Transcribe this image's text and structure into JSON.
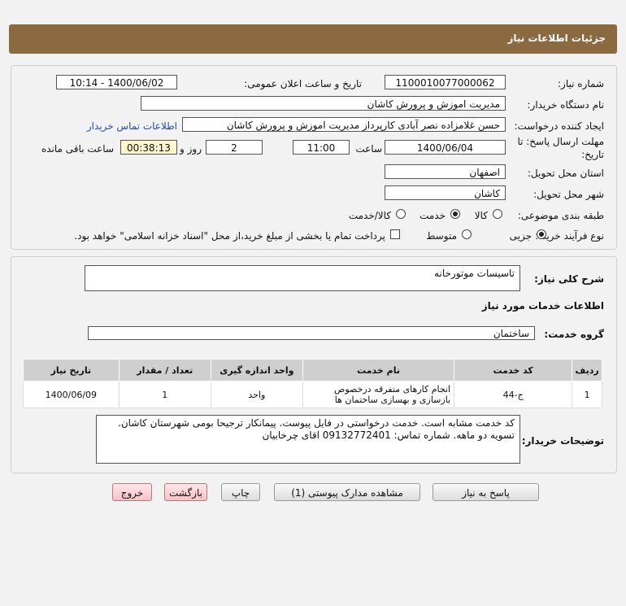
{
  "header": {
    "title": "جزئیات اطلاعات نیاز"
  },
  "fields": {
    "need_number_label": "شماره نیاز:",
    "need_number": "1100010077000062",
    "announce_label": "تاریخ و ساعت اعلان عمومی:",
    "announce_value": "1400/06/02 - 10:14",
    "buyer_org_label": "نام دستگاه خریدار:",
    "buyer_org": "مدیریت اموزش و پرورش کاشان",
    "requester_label": "ایجاد کننده درخواست:",
    "requester": "حسن غلامزاده نصر آبادی کارپرداز مدیریت اموزش و پرورش کاشان",
    "contact_link": "اطلاعات تماس خریدار",
    "deadline_label_1": "مهلت ارسال پاسخ: تا",
    "deadline_label_2": "تاریخ:",
    "deadline_date": "1400/06/04",
    "time_label": "ساعت",
    "deadline_time": "11:00",
    "days_value": "2",
    "days_label": "روز و",
    "remaining_time": "00:38:13",
    "remaining_label": "ساعت باقی مانده",
    "province_label": "استان محل تحویل:",
    "province": "اصفهان",
    "city_label": "شهر محل تحویل:",
    "city": "کاشان",
    "category_label": "طبقه بندی موضوعی:",
    "category_options": [
      "کالا",
      "خدمت",
      "کالا/خدمت"
    ],
    "category_selected": "خدمت",
    "process_label": "نوع فرآیند خرید :",
    "process_options": [
      "جزیی",
      "متوسط"
    ],
    "process_selected": "جزیی",
    "payment_note": "پرداخت تمام یا بخشی از مبلغ خرید،از محل \"اسناد خزانه اسلامی\" خواهد بود."
  },
  "description": {
    "label": "شرح کلی نیاز:",
    "value": "تاسیسات موتورخانه"
  },
  "services": {
    "section_title": "اطلاعات خدمات مورد نیاز",
    "group_label": "گروه خدمت:",
    "group_value": "ساختمان",
    "table": {
      "headers": [
        "ردیف",
        "کد خدمت",
        "نام خدمت",
        "واحد اندازه گیری",
        "تعداد / مقدار",
        "تاریخ نیاز"
      ],
      "rows": [
        [
          "1",
          "ج-44",
          "انجام کارهای متفرقه درخصوص بازسازی و بهسازی ساختمان ها",
          "واحد",
          "1",
          "1400/06/09"
        ]
      ]
    }
  },
  "buyer_notes": {
    "label": "توضیحات خریدار:",
    "text": "کد خدمت مشابه است. خدمت درخواستی در فایل پیوست. پیمانکار ترجیحا بومی شهرستان کاشان. تسویه دو ماهه. شماره تماس: 09132772401 اقای چرخابیان"
  },
  "buttons": {
    "reply": "پاسخ به نیاز",
    "attachments": "مشاهده مدارک پیوستی (1)",
    "print": "چاپ",
    "back": "بازگشت",
    "exit": "خروج"
  }
}
